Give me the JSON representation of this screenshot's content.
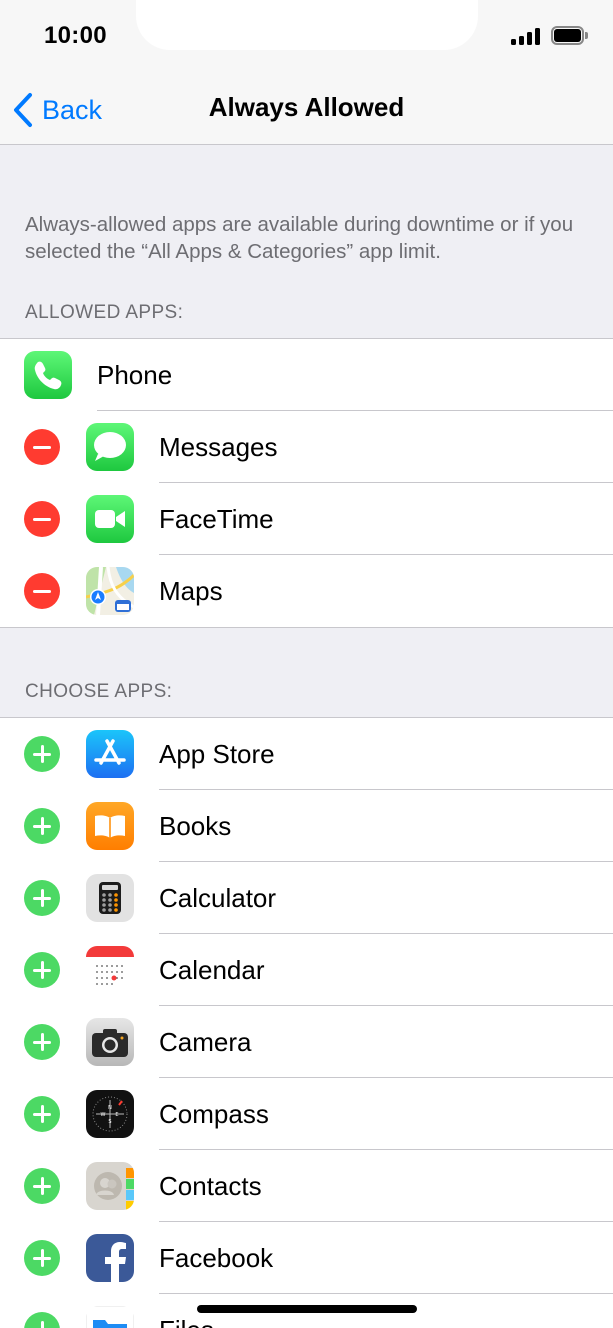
{
  "status_bar": {
    "time": "10:00"
  },
  "nav": {
    "back_label": "Back",
    "title": "Always Allowed"
  },
  "description": "Always-allowed apps are available during downtime or if you selected the “All Apps & Categories” app limit.",
  "allowed_section": {
    "header": "ALLOWED APPS:",
    "items": [
      {
        "label": "Phone",
        "icon": "phone-icon",
        "control": "none"
      },
      {
        "label": "Messages",
        "icon": "messages-icon",
        "control": "remove"
      },
      {
        "label": "FaceTime",
        "icon": "facetime-icon",
        "control": "remove"
      },
      {
        "label": "Maps",
        "icon": "maps-icon",
        "control": "remove"
      }
    ]
  },
  "choose_section": {
    "header": "CHOOSE APPS:",
    "items": [
      {
        "label": "App Store",
        "icon": "app-store-icon",
        "control": "add"
      },
      {
        "label": "Books",
        "icon": "books-icon",
        "control": "add"
      },
      {
        "label": "Calculator",
        "icon": "calculator-icon",
        "control": "add"
      },
      {
        "label": "Calendar",
        "icon": "calendar-icon",
        "control": "add"
      },
      {
        "label": "Camera",
        "icon": "camera-icon",
        "control": "add"
      },
      {
        "label": "Compass",
        "icon": "compass-icon",
        "control": "add"
      },
      {
        "label": "Contacts",
        "icon": "contacts-icon",
        "control": "add"
      },
      {
        "label": "Facebook",
        "icon": "facebook-icon",
        "control": "add"
      },
      {
        "label": "Files",
        "icon": "files-icon",
        "control": "add"
      }
    ]
  },
  "colors": {
    "accent": "#007aff",
    "remove": "#ff3b30",
    "add": "#4cd964",
    "group_background": "#efeff4",
    "separator": "#c8c7cc",
    "secondary_text": "#6d6d72"
  }
}
